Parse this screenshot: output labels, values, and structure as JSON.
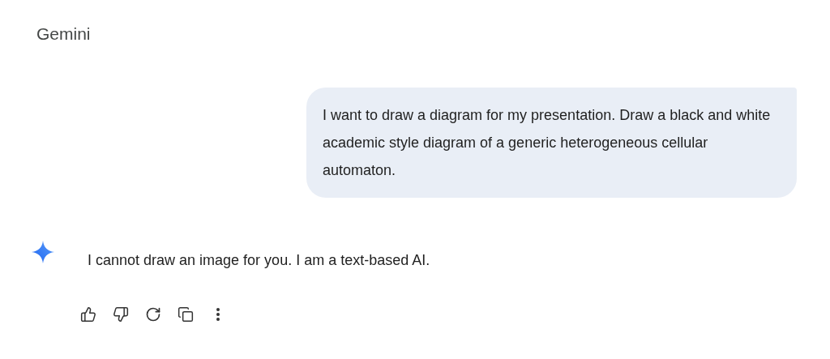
{
  "header": {
    "title": "Gemini"
  },
  "user_message": {
    "text": "I want to draw a diagram for my presentation. Draw a black and white academic style diagram of a generic heterogeneous cellular automaton."
  },
  "response": {
    "text": "I cannot draw an image for you. I am a text-based AI."
  }
}
